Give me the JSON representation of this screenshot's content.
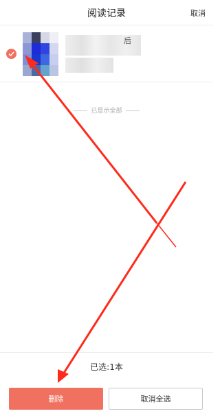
{
  "header": {
    "title": "阅读记录",
    "cancel_label": "取消"
  },
  "record": {
    "checked": true,
    "title_visible_tail": "后",
    "cover_icon": "book-cover-image"
  },
  "list_footer": {
    "all_shown_text": "已显示全部"
  },
  "footer": {
    "selected_count_text": "已选:1本",
    "delete_label": "删除",
    "deselect_all_label": "取消全选"
  },
  "colors": {
    "accent": "#f0715f",
    "annotation_red": "#ff2a1a"
  }
}
